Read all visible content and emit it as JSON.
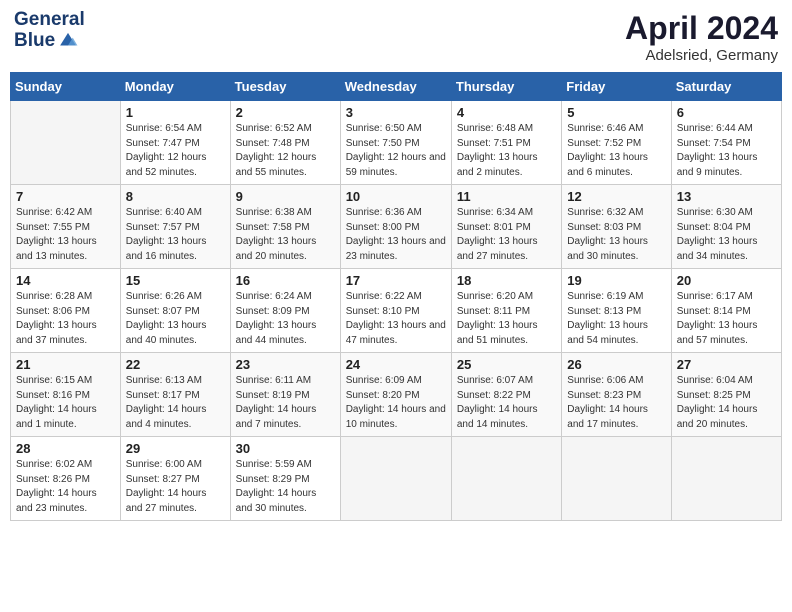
{
  "header": {
    "logo_line1": "General",
    "logo_line2": "Blue",
    "title": "April 2024",
    "subtitle": "Adelsried, Germany"
  },
  "columns": [
    "Sunday",
    "Monday",
    "Tuesday",
    "Wednesday",
    "Thursday",
    "Friday",
    "Saturday"
  ],
  "weeks": [
    [
      {
        "day": "",
        "sunrise": "",
        "sunset": "",
        "daylight": ""
      },
      {
        "day": "1",
        "sunrise": "Sunrise: 6:54 AM",
        "sunset": "Sunset: 7:47 PM",
        "daylight": "Daylight: 12 hours and 52 minutes."
      },
      {
        "day": "2",
        "sunrise": "Sunrise: 6:52 AM",
        "sunset": "Sunset: 7:48 PM",
        "daylight": "Daylight: 12 hours and 55 minutes."
      },
      {
        "day": "3",
        "sunrise": "Sunrise: 6:50 AM",
        "sunset": "Sunset: 7:50 PM",
        "daylight": "Daylight: 12 hours and 59 minutes."
      },
      {
        "day": "4",
        "sunrise": "Sunrise: 6:48 AM",
        "sunset": "Sunset: 7:51 PM",
        "daylight": "Daylight: 13 hours and 2 minutes."
      },
      {
        "day": "5",
        "sunrise": "Sunrise: 6:46 AM",
        "sunset": "Sunset: 7:52 PM",
        "daylight": "Daylight: 13 hours and 6 minutes."
      },
      {
        "day": "6",
        "sunrise": "Sunrise: 6:44 AM",
        "sunset": "Sunset: 7:54 PM",
        "daylight": "Daylight: 13 hours and 9 minutes."
      }
    ],
    [
      {
        "day": "7",
        "sunrise": "Sunrise: 6:42 AM",
        "sunset": "Sunset: 7:55 PM",
        "daylight": "Daylight: 13 hours and 13 minutes."
      },
      {
        "day": "8",
        "sunrise": "Sunrise: 6:40 AM",
        "sunset": "Sunset: 7:57 PM",
        "daylight": "Daylight: 13 hours and 16 minutes."
      },
      {
        "day": "9",
        "sunrise": "Sunrise: 6:38 AM",
        "sunset": "Sunset: 7:58 PM",
        "daylight": "Daylight: 13 hours and 20 minutes."
      },
      {
        "day": "10",
        "sunrise": "Sunrise: 6:36 AM",
        "sunset": "Sunset: 8:00 PM",
        "daylight": "Daylight: 13 hours and 23 minutes."
      },
      {
        "day": "11",
        "sunrise": "Sunrise: 6:34 AM",
        "sunset": "Sunset: 8:01 PM",
        "daylight": "Daylight: 13 hours and 27 minutes."
      },
      {
        "day": "12",
        "sunrise": "Sunrise: 6:32 AM",
        "sunset": "Sunset: 8:03 PM",
        "daylight": "Daylight: 13 hours and 30 minutes."
      },
      {
        "day": "13",
        "sunrise": "Sunrise: 6:30 AM",
        "sunset": "Sunset: 8:04 PM",
        "daylight": "Daylight: 13 hours and 34 minutes."
      }
    ],
    [
      {
        "day": "14",
        "sunrise": "Sunrise: 6:28 AM",
        "sunset": "Sunset: 8:06 PM",
        "daylight": "Daylight: 13 hours and 37 minutes."
      },
      {
        "day": "15",
        "sunrise": "Sunrise: 6:26 AM",
        "sunset": "Sunset: 8:07 PM",
        "daylight": "Daylight: 13 hours and 40 minutes."
      },
      {
        "day": "16",
        "sunrise": "Sunrise: 6:24 AM",
        "sunset": "Sunset: 8:09 PM",
        "daylight": "Daylight: 13 hours and 44 minutes."
      },
      {
        "day": "17",
        "sunrise": "Sunrise: 6:22 AM",
        "sunset": "Sunset: 8:10 PM",
        "daylight": "Daylight: 13 hours and 47 minutes."
      },
      {
        "day": "18",
        "sunrise": "Sunrise: 6:20 AM",
        "sunset": "Sunset: 8:11 PM",
        "daylight": "Daylight: 13 hours and 51 minutes."
      },
      {
        "day": "19",
        "sunrise": "Sunrise: 6:19 AM",
        "sunset": "Sunset: 8:13 PM",
        "daylight": "Daylight: 13 hours and 54 minutes."
      },
      {
        "day": "20",
        "sunrise": "Sunrise: 6:17 AM",
        "sunset": "Sunset: 8:14 PM",
        "daylight": "Daylight: 13 hours and 57 minutes."
      }
    ],
    [
      {
        "day": "21",
        "sunrise": "Sunrise: 6:15 AM",
        "sunset": "Sunset: 8:16 PM",
        "daylight": "Daylight: 14 hours and 1 minute."
      },
      {
        "day": "22",
        "sunrise": "Sunrise: 6:13 AM",
        "sunset": "Sunset: 8:17 PM",
        "daylight": "Daylight: 14 hours and 4 minutes."
      },
      {
        "day": "23",
        "sunrise": "Sunrise: 6:11 AM",
        "sunset": "Sunset: 8:19 PM",
        "daylight": "Daylight: 14 hours and 7 minutes."
      },
      {
        "day": "24",
        "sunrise": "Sunrise: 6:09 AM",
        "sunset": "Sunset: 8:20 PM",
        "daylight": "Daylight: 14 hours and 10 minutes."
      },
      {
        "day": "25",
        "sunrise": "Sunrise: 6:07 AM",
        "sunset": "Sunset: 8:22 PM",
        "daylight": "Daylight: 14 hours and 14 minutes."
      },
      {
        "day": "26",
        "sunrise": "Sunrise: 6:06 AM",
        "sunset": "Sunset: 8:23 PM",
        "daylight": "Daylight: 14 hours and 17 minutes."
      },
      {
        "day": "27",
        "sunrise": "Sunrise: 6:04 AM",
        "sunset": "Sunset: 8:25 PM",
        "daylight": "Daylight: 14 hours and 20 minutes."
      }
    ],
    [
      {
        "day": "28",
        "sunrise": "Sunrise: 6:02 AM",
        "sunset": "Sunset: 8:26 PM",
        "daylight": "Daylight: 14 hours and 23 minutes."
      },
      {
        "day": "29",
        "sunrise": "Sunrise: 6:00 AM",
        "sunset": "Sunset: 8:27 PM",
        "daylight": "Daylight: 14 hours and 27 minutes."
      },
      {
        "day": "30",
        "sunrise": "Sunrise: 5:59 AM",
        "sunset": "Sunset: 8:29 PM",
        "daylight": "Daylight: 14 hours and 30 minutes."
      },
      {
        "day": "",
        "sunrise": "",
        "sunset": "",
        "daylight": ""
      },
      {
        "day": "",
        "sunrise": "",
        "sunset": "",
        "daylight": ""
      },
      {
        "day": "",
        "sunrise": "",
        "sunset": "",
        "daylight": ""
      },
      {
        "day": "",
        "sunrise": "",
        "sunset": "",
        "daylight": ""
      }
    ]
  ]
}
